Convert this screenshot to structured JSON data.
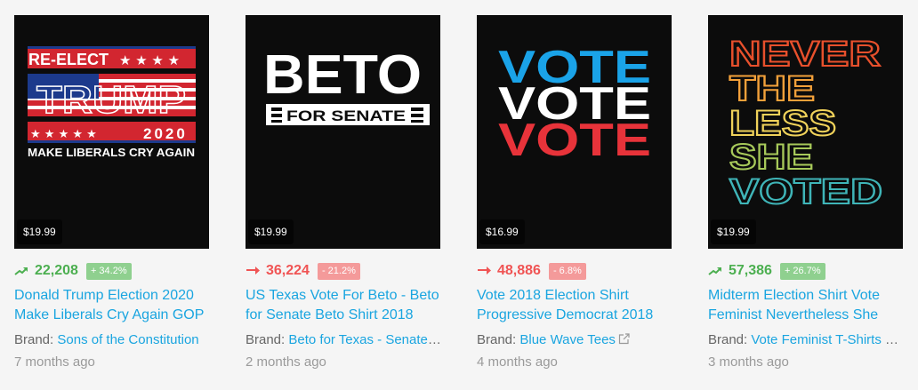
{
  "products": [
    {
      "price": "$19.99",
      "trend": "up",
      "trend_icon": "arrow-trending-up-icon",
      "rank": "22,208",
      "change": "+ 34.2%",
      "title": "Donald Trump Election 2020 Make Liberals Cry Again GOP",
      "brand_prefix": "Brand: ",
      "brand": "Sons of the Constitution",
      "age": "7 months ago",
      "design": {
        "line1": "RE-ELECT",
        "line2": "TRUMP",
        "line3": "2020",
        "line4": "MAKE LIBERALS CRY AGAIN",
        "stars": "★ ★ ★ ★",
        "stars2": "★ ★ ★ ★ ★"
      }
    },
    {
      "price": "$19.99",
      "trend": "down",
      "trend_icon": "arrow-trending-down-icon",
      "rank": "36,224",
      "change": "- 21.2%",
      "title": "US Texas Vote For Beto - Beto for Senate Beto Shirt 2018",
      "brand_prefix": "Brand: ",
      "brand": "Beto for Texas - Senate Shirt",
      "age": "2 months ago",
      "design": {
        "line1": "BETO",
        "line2": "FOR SENATE"
      }
    },
    {
      "price": "$16.99",
      "trend": "down",
      "trend_icon": "arrow-trending-down-icon",
      "rank": "48,886",
      "change": "- 6.8%",
      "title": "Vote 2018 Election Shirt Progressive Democrat 2018",
      "brand_prefix": "Brand: ",
      "brand": "Blue Wave Tees",
      "external_icon": "external-link-icon",
      "age": "4 months ago",
      "design": {
        "word": "VOTE"
      }
    },
    {
      "price": "$19.99",
      "trend": "up",
      "trend_icon": "arrow-trending-up-icon",
      "rank": "57,386",
      "change": "+ 26.7%",
      "title": "Midterm Election Shirt Vote Feminist Nevertheless She",
      "brand_prefix": "Brand: ",
      "brand": "Vote Feminist T-Shirts & Gifts",
      "age": "3 months ago",
      "design": {
        "line1": "NEVER",
        "line2": "THE",
        "line3": "LESS",
        "line4": "SHE",
        "line5": "VOTED"
      }
    }
  ],
  "colors": {
    "up": "#4caf50",
    "down": "#f05454",
    "link": "#1aa5e0",
    "usa_red": "#d22630",
    "usa_blue": "#1c3a8c",
    "vote_blue": "#1aa3e8",
    "vote_red": "#e8333a"
  }
}
